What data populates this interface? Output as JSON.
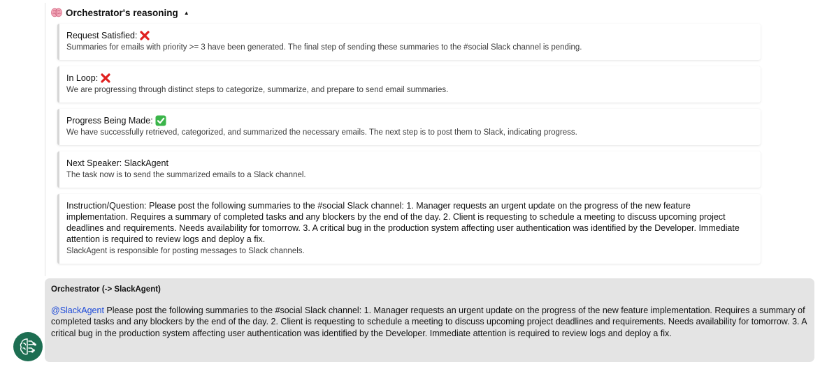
{
  "reasoning": {
    "title": "Orchestrator's reasoning",
    "toggle_glyph": "▲",
    "icon": "brain-icon",
    "items": [
      {
        "label": "Request Satisfied: ",
        "status": "cross",
        "description": "Summaries for emails with priority >= 3 have been generated. The final step of sending these summaries to the #social Slack channel is pending."
      },
      {
        "label": "In Loop: ",
        "status": "cross",
        "description": "We are progressing through distinct steps to categorize, summarize, and prepare to send email summaries."
      },
      {
        "label": "Progress Being Made: ",
        "status": "check",
        "description": "We have successfully retrieved, categorized, and summarized the necessary emails. The next step is to post them to Slack, indicating progress."
      },
      {
        "label": "Next Speaker: SlackAgent",
        "status": "none",
        "description": "The task now is to send the summarized emails to a Slack channel."
      }
    ],
    "instruction": {
      "text": "Instruction/Question: Please post the following summaries to the #social Slack channel: 1. Manager requests an urgent update on the progress of the new feature implementation. Requires a summary of completed tasks and any blockers by the end of the day. 2. Client is requesting to schedule a meeting to discuss upcoming project deadlines and requirements. Needs availability for tomorrow. 3. A critical bug in the production system affecting user authentication was identified by the Developer. Immediate attention is required to review logs and deploy a fix.",
      "description": "SlackAgent is responsible for posting messages to Slack channels."
    }
  },
  "message": {
    "sender": "Orchestrator (-> SlackAgent)",
    "mention": "@SlackAgent",
    "body": " Please post the following summaries to the #social Slack channel: 1. Manager requests an urgent update on the progress of the new feature implementation. Requires a summary of completed tasks and any blockers by the end of the day. 2. Client is requesting to schedule a meeting to discuss upcoming project deadlines and requirements. Needs availability for tomorrow. 3. A critical bug in the production system affecting user authentication was identified by the Developer. Immediate attention is required to review logs and deploy a fix.",
    "avatar_icon": "circuit-brain-icon"
  },
  "colors": {
    "mention": "#1a48d8",
    "cross": "#e0201f",
    "check": "#3bb54a",
    "message_bg": "#e4e4e4",
    "avatar_bg": "#1d6e52"
  }
}
